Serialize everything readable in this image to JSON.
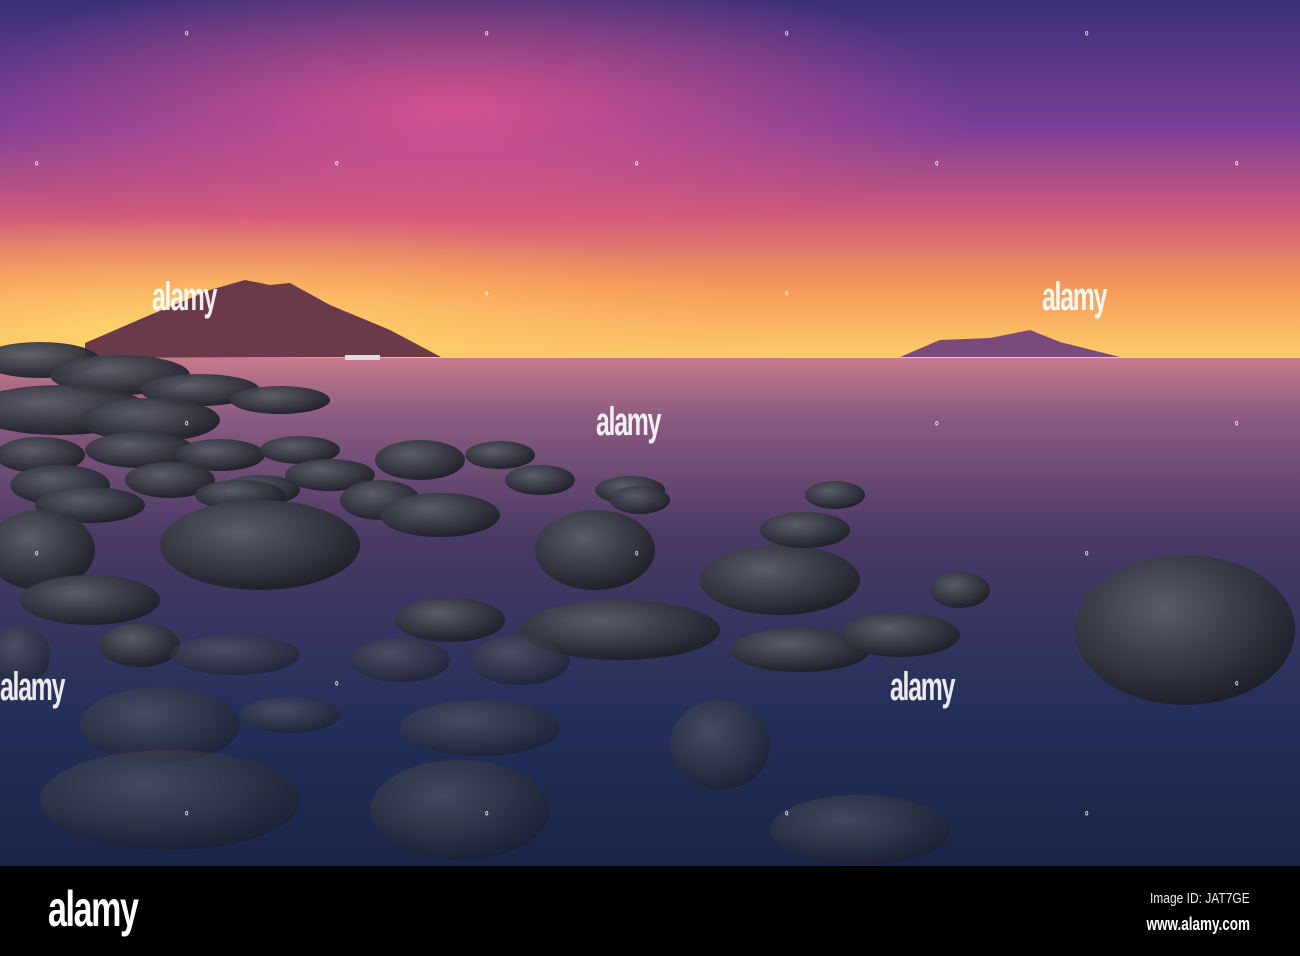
{
  "watermark": {
    "text": "alamy"
  },
  "footer": {
    "logo": "alamy",
    "image_id": "Image ID: JAT7GE",
    "url": "www.alamy.com"
  },
  "colors": {
    "sky_top": "#3c3280",
    "sky_mid": "#b04a8a",
    "horizon_glow": "#ffc85a",
    "sea_near": "#1e2a50",
    "rock": "#2a2c36"
  }
}
